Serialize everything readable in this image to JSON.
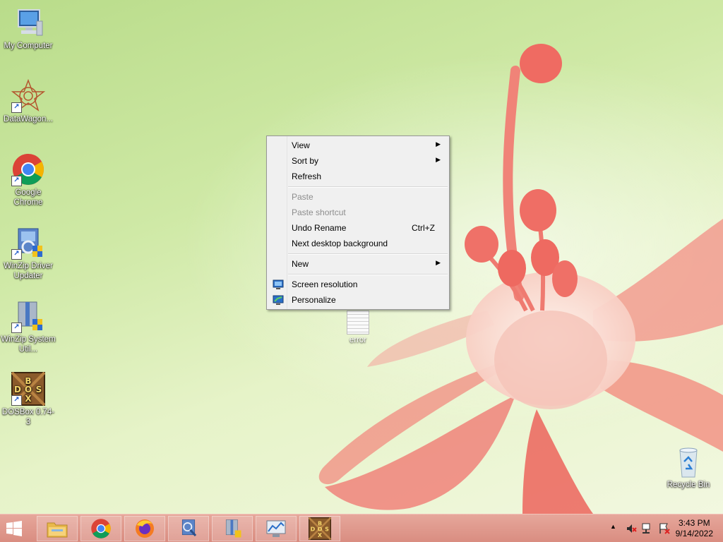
{
  "desktop": {
    "icons": [
      {
        "label": "My Computer"
      },
      {
        "label": "DataWagon..."
      },
      {
        "label": "Google Chrome"
      },
      {
        "label": "WinZip Driver Updater"
      },
      {
        "label": "WinZip System Util..."
      },
      {
        "label": "DOSBox 0.74-3"
      }
    ],
    "recycle_bin": {
      "label": "Recycle Bin"
    },
    "file": {
      "label": "error"
    }
  },
  "context_menu": {
    "view": "View",
    "sort_by": "Sort by",
    "refresh": "Refresh",
    "paste": "Paste",
    "paste_shortcut": "Paste shortcut",
    "undo_rename": "Undo Rename",
    "undo_shortcut": "Ctrl+Z",
    "next_background": "Next desktop background",
    "new": "New",
    "screen_resolution": "Screen resolution",
    "personalize": "Personalize"
  },
  "taskbar": {
    "time": "3:43 PM",
    "date": "9/14/2022"
  },
  "colors": {
    "taskbar": "#d98c80",
    "menu_bg": "#f0f0f0",
    "disabled_text": "#8d8d8d"
  }
}
